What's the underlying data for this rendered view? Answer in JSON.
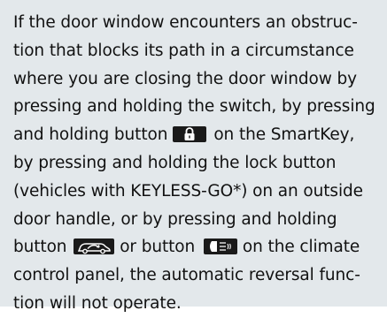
{
  "note": {
    "lines": [
      "If the door window encounters an obstruc-",
      "tion that blocks its path in a circumstance",
      "where you are closing the door window by",
      "pressing and holding the switch, by pressing",
      "and holding button",
      "on the SmartKey,",
      "by pressing and holding the lock button",
      "(vehicles with KEYLESS-GO*) on an outside",
      "door handle, or by pressing and holding",
      "button",
      "or button",
      "on the climate",
      "control panel, the automatic reversal func-",
      "tion will not operate."
    ]
  },
  "icons": {
    "smartkey_lock": "lock-icon",
    "recirculation": "car-recirculation-icon",
    "rear_defrost": "rear-window-defrost-icon"
  },
  "colors": {
    "box_background": "#e3e8eb",
    "text": "#111111",
    "icon_background": "#1a1a1a"
  }
}
